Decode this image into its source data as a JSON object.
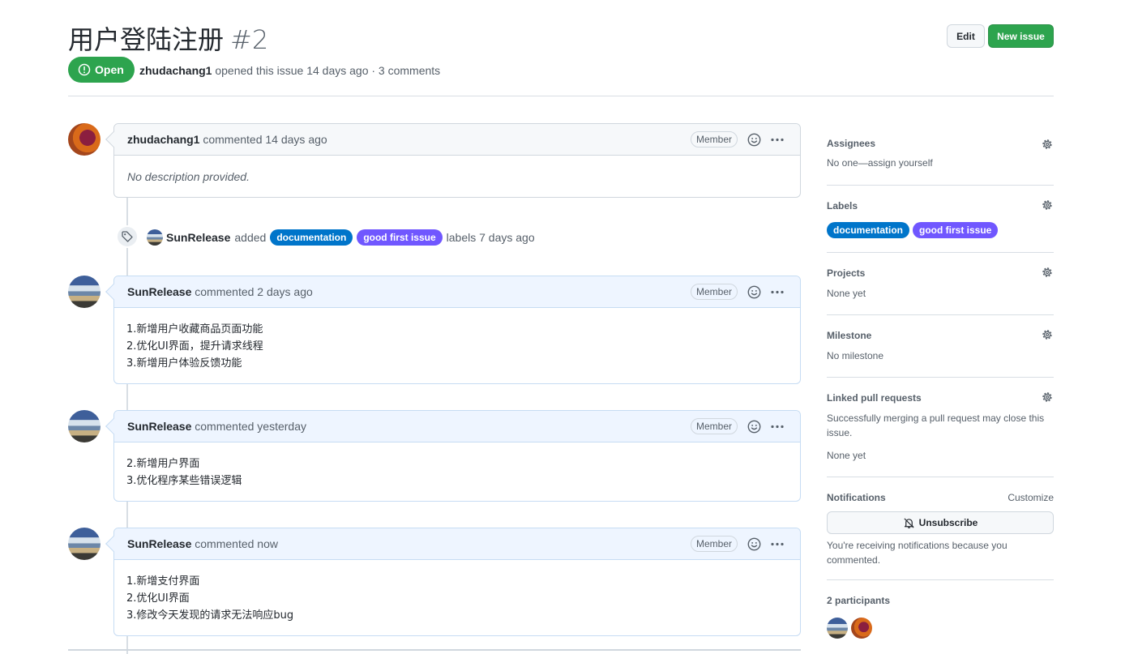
{
  "issue": {
    "title": "用户登陆注册",
    "number": "#2",
    "state": "Open",
    "author": "zhudachang1",
    "meta_text": " opened this issue 14 days ago · 3 comments",
    "edit_label": "Edit",
    "new_issue_label": "New issue"
  },
  "timeline": {
    "first_comment": {
      "author": "zhudachang1",
      "time": " commented 14 days ago",
      "role": "Member",
      "body": "No description provided."
    },
    "label_event": {
      "actor": "SunRelease",
      "action": "added",
      "labels": [
        "documentation",
        "good first issue"
      ],
      "suffix": "labels 7 days ago"
    },
    "comments": [
      {
        "author": "SunRelease",
        "time": " commented 2 days ago",
        "role": "Member",
        "lines": [
          "1.新增用户收藏商品页面功能",
          "2.优化UI界面，提升请求线程",
          "3.新增用户体验反馈功能"
        ]
      },
      {
        "author": "SunRelease",
        "time": " commented yesterday",
        "role": "Member",
        "lines": [
          "2.新增用户界面",
          "3.优化程序某些错误逻辑"
        ]
      },
      {
        "author": "SunRelease",
        "time": " commented now",
        "role": "Member",
        "lines": [
          "1.新增支付界面",
          "2.优化UI界面",
          "3.修改今天发现的请求无法响应bug"
        ]
      }
    ]
  },
  "sidebar": {
    "assignees": {
      "title": "Assignees",
      "value": "No one—assign yourself"
    },
    "labels": {
      "title": "Labels",
      "items": [
        "documentation",
        "good first issue"
      ]
    },
    "projects": {
      "title": "Projects",
      "value": "None yet"
    },
    "milestone": {
      "title": "Milestone",
      "value": "No milestone"
    },
    "linked_prs": {
      "title": "Linked pull requests",
      "description": "Successfully merging a pull request may close this issue.",
      "value": "None yet"
    },
    "notifications": {
      "title": "Notifications",
      "customize": "Customize",
      "button": "Unsubscribe",
      "reason": "You're receiving notifications because you commented."
    },
    "participants": {
      "title": "2 participants"
    }
  },
  "colors": {
    "open_green": "#2da44e",
    "label_documentation": "#0075ca",
    "label_good_first_issue": "#7057ff"
  },
  "icons": [
    "issue-opened-icon",
    "smiley-icon",
    "kebab-horizontal-icon",
    "tag-icon",
    "gear-icon",
    "bell-slash-icon"
  ]
}
